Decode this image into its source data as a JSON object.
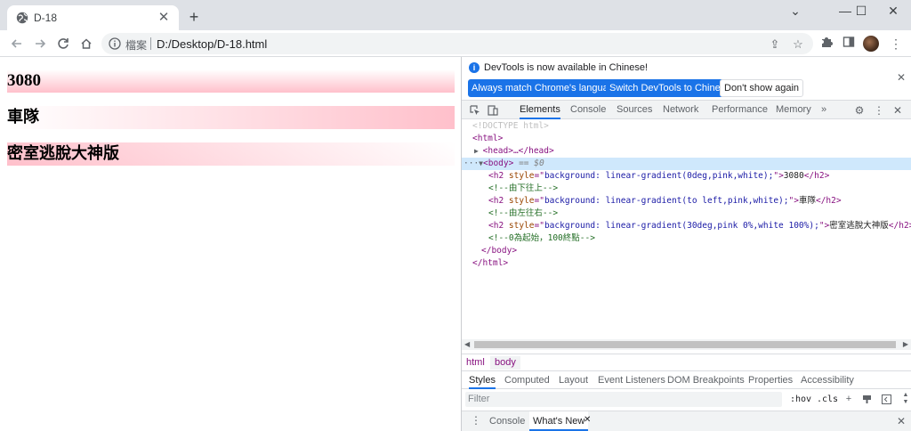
{
  "tab": {
    "title": "D-18",
    "close_glyph": "✕",
    "new_tab_glyph": "+"
  },
  "window_controls": {
    "minimize": "⌄",
    "restore": "—",
    "maximize": "☐",
    "close": "✕"
  },
  "toolbar": {
    "back_icon": "arrow-left-icon",
    "forward_icon": "arrow-right-icon",
    "reload_icon": "reload-icon",
    "home_icon": "home-icon",
    "site_label": "檔案",
    "url": "D:/Desktop/D-18.html"
  },
  "page": {
    "headings": [
      "3080",
      "車隊",
      "密室逃脫大神版"
    ],
    "heading_backgrounds": [
      "linear-gradient(0deg,pink,white)",
      "linear-gradient(to left,pink,white)",
      "linear-gradient(30deg,pink 0%,white 100%)"
    ]
  },
  "devtools": {
    "banner": {
      "message": "DevTools is now available in Chinese!",
      "btn_match": "Always match Chrome's language",
      "btn_switch": "Switch DevTools to Chinese",
      "btn_dismiss": "Don't show again"
    },
    "tabs": [
      "Elements",
      "Console",
      "Sources",
      "Network",
      "Performance",
      "Memory"
    ],
    "more_tabs": "»",
    "dom": {
      "doctype": "<!DOCTYPE html>",
      "html_open": "<html>",
      "head": "<head>…</head>",
      "body_open": "<body>",
      "body_eq": "== $0",
      "ellipsis": "···",
      "h2_open": "<h2 ",
      "style_attr": "style",
      "eq_quote": "=\"",
      "quote_gt": "\">",
      "h2_close": "</h2>",
      "h2_1_style": "background: linear-gradient(0deg,pink,white);",
      "h2_1_text": "3080",
      "c1": "<!--由下往上-->",
      "h2_2_style": "background: linear-gradient(to left,pink,white);",
      "h2_2_text": "車隊",
      "c2": "<!--由左往右-->",
      "h2_3_style": "background: linear-gradient(30deg,pink 0%,white 100%);",
      "h2_3_text": "密室逃脫大神版",
      "c3": "<!--0為起始，100終點-->",
      "body_close": "</body>",
      "html_close": "</html>"
    },
    "breadcrumbs": [
      "html",
      "body"
    ],
    "styles_tabs": [
      "Styles",
      "Computed",
      "Layout",
      "Event Listeners",
      "DOM Breakpoints",
      "Properties",
      "Accessibility"
    ],
    "filter_placeholder": "Filter",
    "hov": ":hov",
    "cls": ".cls",
    "drawer_tabs": [
      "Console",
      "What's New"
    ]
  }
}
